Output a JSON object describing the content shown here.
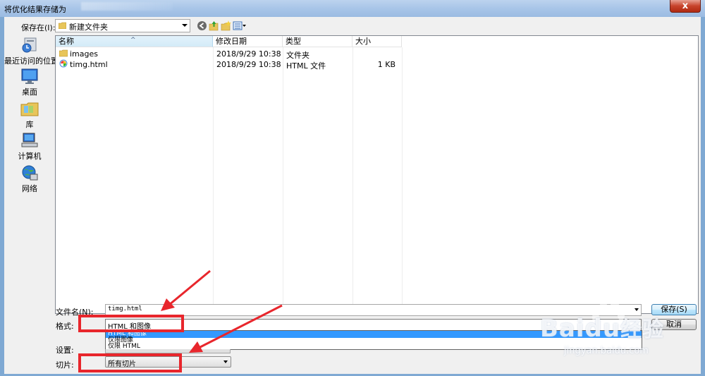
{
  "window": {
    "title": "将优化结果存储为",
    "close_label": "x"
  },
  "toolbar": {
    "save_in_label": "保存在(I):",
    "save_in_value": "新建文件夹"
  },
  "places": [
    {
      "label": "最近访问的位置",
      "icon": "recent-places-icon"
    },
    {
      "label": "桌面",
      "icon": "desktop-icon"
    },
    {
      "label": "库",
      "icon": "libraries-icon"
    },
    {
      "label": "计算机",
      "icon": "computer-icon"
    },
    {
      "label": "网络",
      "icon": "network-icon"
    }
  ],
  "columns": [
    "名称",
    "修改日期",
    "类型",
    "大小"
  ],
  "files": [
    {
      "name": "images",
      "modified": "2018/9/29 10:38",
      "type": "文件夹",
      "size": "",
      "icon": "folder-icon"
    },
    {
      "name": "timg.html",
      "modified": "2018/9/29 10:38",
      "type": "HTML 文件",
      "size": "1 KB",
      "icon": "html-file-icon"
    }
  ],
  "form": {
    "filename_label": "文件名(N):",
    "filename_value": "timg.html",
    "format_label": "格式:",
    "format_value": "HTML 和图像",
    "format_options": [
      "HTML 和图像",
      "仅限图像",
      "仅限 HTML"
    ],
    "settings_label": "设置:",
    "slices_label": "切片:",
    "slices_value": "所有切片"
  },
  "buttons": {
    "save": "保存(S)",
    "cancel": "取消"
  },
  "watermark": {
    "brand": "Bai",
    "brand2": "du",
    "brand3": "经验",
    "url": "jingyan.baidu.com"
  },
  "colors": {
    "annotation": "#e8262c",
    "selection": "#3399ff"
  }
}
